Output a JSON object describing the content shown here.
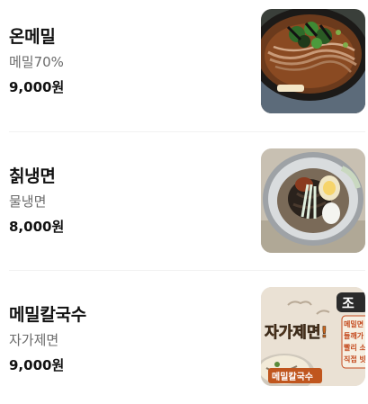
{
  "menu": {
    "items": [
      {
        "name": "온메밀",
        "description": "메밀70%",
        "price": "9,000원",
        "image": "hot-soba-bowl-photo"
      },
      {
        "name": "칡냉면",
        "description": "물냉면",
        "price": "8,000원",
        "image": "arrowroot-cold-noodle-photo"
      },
      {
        "name": "메밀칼국수",
        "description": "자가제면",
        "price": "9,000원",
        "image": "buckwheat-kalguksu-promo-photo",
        "promo": {
          "headline": "자가제면!",
          "badge": "메밀칼국수",
          "corner": "조",
          "side_lines": [
            "메밀면",
            "들깨가",
            "빨리 소",
            "직접 빗"
          ]
        }
      }
    ]
  },
  "colors": {
    "text_primary": "#111111",
    "text_secondary": "#6b6b6b",
    "divider": "#f1f1f1",
    "promo_accent": "#d2691e"
  }
}
